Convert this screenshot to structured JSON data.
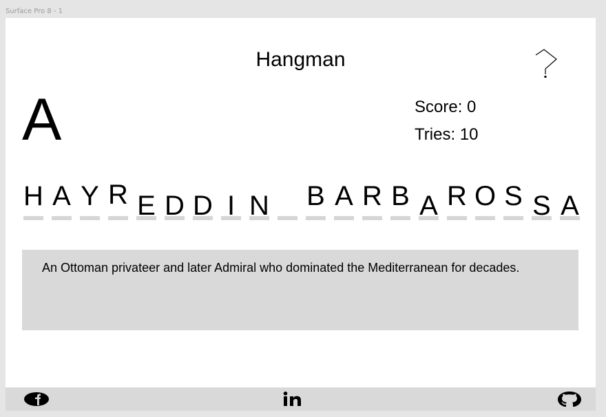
{
  "frame": {
    "label": "Surface Pro 8 - 1"
  },
  "header": {
    "title": "Hangman",
    "help_icon": "question-mark-icon"
  },
  "game": {
    "current_letter": "A",
    "score_text": "Score: 0",
    "tries_text": "Tries: 10",
    "word": [
      {
        "char": "H",
        "offset": 0
      },
      {
        "char": "A",
        "offset": 0
      },
      {
        "char": "Y",
        "offset": 0
      },
      {
        "char": "R",
        "offset": -2
      },
      {
        "char": "E",
        "offset": 14
      },
      {
        "char": "D",
        "offset": 14
      },
      {
        "char": "D",
        "offset": 14
      },
      {
        "char": "I",
        "offset": 14
      },
      {
        "char": "N",
        "offset": 14
      },
      {
        "char": "",
        "offset": 0
      },
      {
        "char": "B",
        "offset": 0
      },
      {
        "char": "A",
        "offset": 0
      },
      {
        "char": "R",
        "offset": 0
      },
      {
        "char": "B",
        "offset": 0
      },
      {
        "char": "A",
        "offset": 14
      },
      {
        "char": "R",
        "offset": 0
      },
      {
        "char": "O",
        "offset": 0
      },
      {
        "char": "S",
        "offset": 0
      },
      {
        "char": "S",
        "offset": 14
      },
      {
        "char": "A",
        "offset": 14
      }
    ],
    "hint": "An Ottoman privateer and later Admiral who dominated the Mediterranean for decades."
  },
  "footer": {
    "icons": [
      "facebook-icon",
      "linkedin-icon",
      "github-icon"
    ]
  }
}
